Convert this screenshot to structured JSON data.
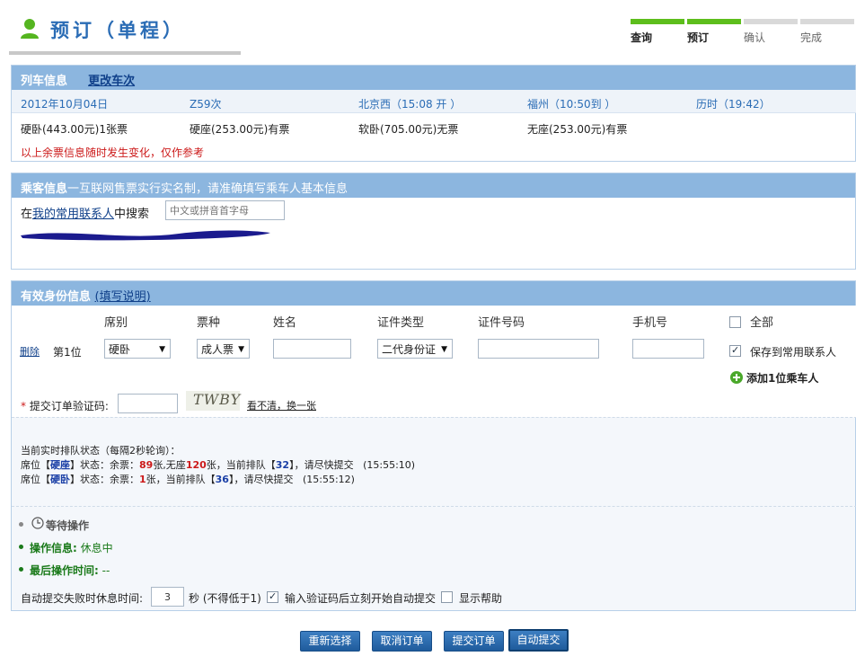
{
  "header": {
    "title": "预订（单程）",
    "steps": [
      {
        "label": "查询",
        "done": true
      },
      {
        "label": "预订",
        "done": true
      },
      {
        "label": "确认",
        "done": false
      },
      {
        "label": "完成",
        "done": false
      }
    ]
  },
  "train": {
    "section_title": "列车信息",
    "change_link": "更改车次",
    "date": "2012年10月04日",
    "train_no": "Z59次",
    "depart": "北京西（15:08 开 ）",
    "arrive": "福州（10:50到 ）",
    "duration": "历时（19:42）",
    "seats": [
      "硬卧(443.00元)1张票",
      "硬座(253.00元)有票",
      "软卧(705.00元)无票",
      "无座(253.00元)有票"
    ],
    "warning": "以上余票信息随时发生变化，仅作参考"
  },
  "passenger": {
    "section_title": "乘客信息",
    "section_note": "一互联网售票实行实名制，请准确填写乘车人基本信息",
    "search_prefix": "在",
    "search_link": "我的常用联系人",
    "search_suffix": "中搜索",
    "search_placeholder": "中文或拼音首字母"
  },
  "identity": {
    "section_title": "有效身份信息",
    "help_link": "(填写说明)",
    "columns": {
      "seat": "席别",
      "ticket": "票种",
      "name": "姓名",
      "id_type": "证件类型",
      "id_no": "证件号码",
      "phone": "手机号",
      "all": "全部"
    },
    "row": {
      "delete": "删除",
      "position": "第1位",
      "seat": "硬卧",
      "ticket": "成人票",
      "id_type": "二代身份证",
      "save_label": "保存到常用联系人"
    },
    "add_passenger": "添加1位乘车人",
    "captcha_star": "*",
    "captcha_label": "提交订单验证码:",
    "captcha_text": "TWBY",
    "captcha_refresh": "看不清，换一张"
  },
  "queue": {
    "title": "当前实时排队状态（每隔2秒轮询）：",
    "lines": [
      {
        "pre": "席位【",
        "seat": "硬座",
        "mid": "】状态：余票：",
        "n1": "89",
        "mid2": "张,无座",
        "n2": "120",
        "mid3": "张，当前排队【",
        "q": "32",
        "post": "】，请尽快提交",
        "time": "(15:55:10)"
      },
      {
        "pre": "席位【",
        "seat": "硬卧",
        "mid": "】状态：余票：",
        "n1": "1",
        "mid2": "张，当前排队【",
        "q": "36",
        "post": "】，请尽快提交",
        "time": "(15:55:12)"
      }
    ]
  },
  "status": {
    "waiting": "等待操作",
    "op_label": "操作信息:",
    "op_value": "休息中",
    "last_label": "最后操作时间:",
    "last_value": "--",
    "retry_label": "自动提交失败时休息时间:",
    "retry_value": "3",
    "retry_unit": "秒 (不得低于1)",
    "auto_submit_label": "输入验证码后立刻开始自动提交",
    "show_help_label": "显示帮助"
  },
  "buttons": {
    "reselect": "重新选择",
    "cancel": "取消订单",
    "submit": "提交订单",
    "auto_submit": "自动提交"
  },
  "colors": {
    "accent": "#2a6cb5",
    "panel_header": "#8cb6df",
    "step_done": "#5dbe1c",
    "warning": "#cc1a1a",
    "button": "#2766a8"
  }
}
